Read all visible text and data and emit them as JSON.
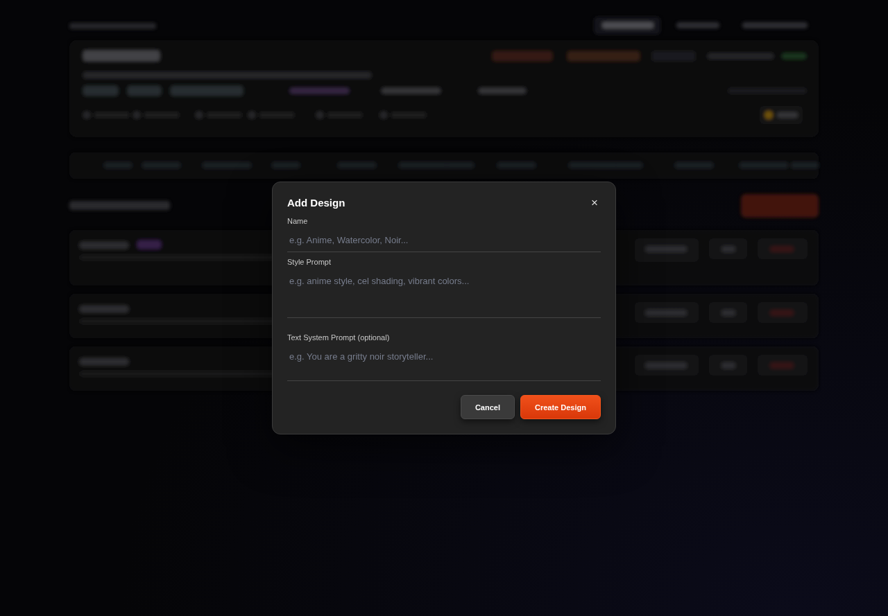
{
  "dialog": {
    "title": "Add Design",
    "close": "×",
    "fields": [
      {
        "label": "Name",
        "placeholder": "e.g. Anime, Watercolor, Noir...",
        "kind": "input"
      },
      {
        "label": "Style Prompt",
        "placeholder": "e.g. anime style, cel shading, vibrant colors...",
        "kind": "textarea"
      },
      {
        "label": "Text System Prompt (optional)",
        "placeholder": "e.g. You are a gritty noir storyteller...",
        "kind": "textarea-short"
      }
    ],
    "buttons": [
      {
        "label": "Cancel",
        "kind": "secondary"
      },
      {
        "label": "Create Design",
        "kind": "primary"
      }
    ]
  }
}
